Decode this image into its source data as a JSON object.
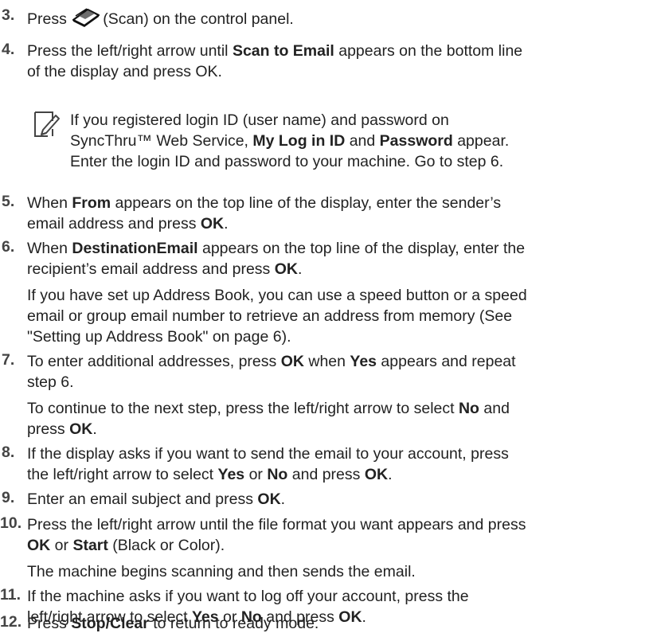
{
  "steps": [
    {
      "num": "3.",
      "lines": [
        [
          "Press ",
          "(Scan) on the control panel."
        ]
      ]
    },
    {
      "num": "4.",
      "lines": [
        [
          "Press the left/right arrow until ",
          {
            "b": "Scan to Email"
          },
          " appears on the bottom line"
        ],
        [
          "of the display and press OK."
        ]
      ]
    },
    {
      "num": "5.",
      "lines": [
        [
          "When ",
          {
            "b": "From"
          },
          " appears on the top line of the display, enter the sender’s"
        ],
        [
          "email address and press ",
          {
            "b": "OK"
          },
          "."
        ]
      ]
    },
    {
      "num": "6.",
      "lines": [
        [
          "When ",
          {
            "b": "DestinationEmail"
          },
          " appears on the top line of the display, enter the"
        ],
        [
          "recipient’s email address and press ",
          {
            "b": "OK"
          },
          "."
        ]
      ],
      "paragraphs": [
        [
          [
            "If you have set up Address Book, you can use a speed button or a speed"
          ],
          [
            "email or group email number to retrieve an address from memory (See"
          ],
          [
            "\"Setting up Address Book\" on page 6)."
          ]
        ]
      ]
    },
    {
      "num": "7.",
      "lines": [
        [
          "To enter additional addresses, press ",
          {
            "b": "OK"
          },
          " when ",
          {
            "b": "Yes"
          },
          " appears and repeat"
        ],
        [
          "step 6."
        ]
      ],
      "paragraphs": [
        [
          [
            "To continue to the next step, press the left/right arrow to select ",
            {
              "b": "No"
            },
            " and"
          ],
          [
            "press ",
            {
              "b": "OK"
            },
            "."
          ]
        ]
      ]
    },
    {
      "num": "8.",
      "lines": [
        [
          "If the display asks if you want to send the email to your account, press"
        ],
        [
          "the left/right arrow to select ",
          {
            "b": "Yes"
          },
          " or ",
          {
            "b": "No"
          },
          " and press ",
          {
            "b": "OK"
          },
          "."
        ]
      ]
    },
    {
      "num": "9.",
      "lines": [
        [
          "Enter an email subject and press ",
          {
            "b": "OK"
          },
          "."
        ]
      ]
    },
    {
      "num": "10.",
      "lines": [
        [
          "Press the left/right arrow until the file format you want appears and press"
        ],
        [
          {
            "b": "OK"
          },
          " or ",
          {
            "b": "Start"
          },
          " (Black or Color)."
        ]
      ],
      "paragraphs": [
        [
          [
            "The machine begins scanning and then sends the email."
          ]
        ]
      ]
    },
    {
      "num": "11.",
      "lines": [
        [
          "If the machine asks if you want to log off your account, press the"
        ],
        [
          "left/right arrow to select ",
          {
            "b": "Yes"
          },
          " or ",
          {
            "b": "No"
          },
          " and press ",
          {
            "b": "OK"
          },
          "."
        ]
      ]
    },
    {
      "num": "12.",
      "lines": [
        [
          "Press ",
          {
            "b": "Stop/Clear"
          },
          " to return to ready mode."
        ]
      ]
    }
  ],
  "note": {
    "icon": "note-pencil-icon",
    "lines": [
      [
        "If you registered login ID (user name) and password on"
      ],
      [
        "SyncThru™ Web Service, ",
        {
          "b": "My Log in ID"
        },
        " and ",
        {
          "b": "Password"
        },
        " appear."
      ],
      [
        "Enter the login ID and password to your machine. Go to step 6."
      ]
    ]
  },
  "scan_icon": "scan-icon"
}
